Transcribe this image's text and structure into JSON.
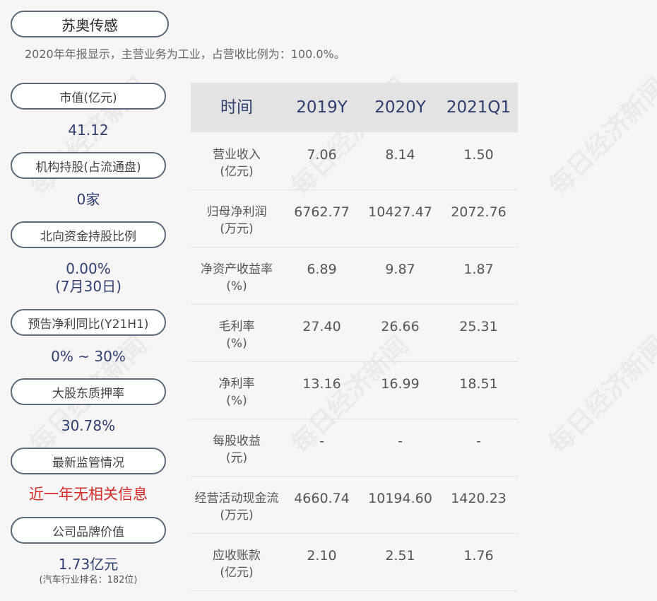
{
  "company": "苏奥传感",
  "summary": "2020年年报显示，主营业务为工业，占营收比例为：100.0%。",
  "watermark": "每日经济新闻",
  "metrics": [
    {
      "label": "市值(亿元)",
      "value": "41.12"
    },
    {
      "label": "机构持股(占流通盘)",
      "value": "0家"
    },
    {
      "label": "北向资金持股比例",
      "value": "0.00%",
      "value2": "(7月30日)"
    },
    {
      "label": "预告净利同比(Y21H1)",
      "value": "0% ~ 30%"
    },
    {
      "label": "大股东质押率",
      "value": "30.78%"
    },
    {
      "label": "最新监管情况",
      "value": "近一年无相关信息"
    },
    {
      "label": "公司品牌价值",
      "value": "1.73亿元",
      "note": "(汽车行业排名：182位)"
    }
  ],
  "table": {
    "headers": [
      "时间",
      "2019Y",
      "2020Y",
      "2021Q1"
    ],
    "rows": [
      {
        "name": "营业收入",
        "unit": "(亿元)",
        "values": [
          "7.06",
          "8.14",
          "1.50"
        ]
      },
      {
        "name": "归母净利润",
        "unit": "(万元)",
        "values": [
          "6762.77",
          "10427.47",
          "2072.76"
        ]
      },
      {
        "name": "净资产收益率",
        "unit": "(%)",
        "values": [
          "6.89",
          "9.87",
          "1.87"
        ]
      },
      {
        "name": "毛利率",
        "unit": "(%)",
        "values": [
          "27.40",
          "26.66",
          "25.31"
        ]
      },
      {
        "name": "净利率",
        "unit": "(%)",
        "values": [
          "13.16",
          "16.99",
          "18.51"
        ]
      },
      {
        "name": "每股收益",
        "unit": "(元)",
        "values": [
          "-",
          "-",
          "-"
        ]
      },
      {
        "name": "经营活动现金流",
        "unit": "(万元)",
        "values": [
          "4660.74",
          "10194.60",
          "1420.23"
        ]
      },
      {
        "name": "应收账款",
        "unit": "(亿元)",
        "values": [
          "2.10",
          "2.51",
          "1.76"
        ]
      }
    ]
  }
}
